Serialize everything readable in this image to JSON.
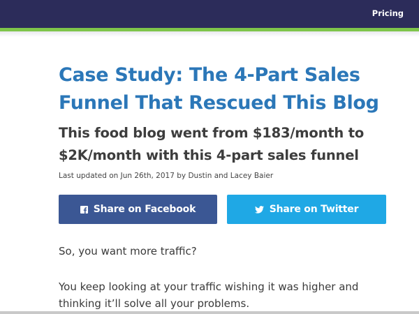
{
  "nav": {
    "pricing_label": "Pricing"
  },
  "article": {
    "title": "Case Study: The 4-Part Sales Funnel That Rescued This Blog",
    "subtitle": "This food blog went from $183/month to $2K/month with this 4-part sales funnel",
    "meta": "Last updated on Jun 26th, 2017 by Dustin and Lacey Baier",
    "paragraphs": [
      "So, you want more traffic?",
      "You keep looking at your traffic wishing it was higher and thinking it’ll solve all your problems."
    ]
  },
  "share": {
    "facebook_label": "Share on Facebook",
    "twitter_label": "Share on Twitter",
    "facebook_icon": "facebook-icon",
    "twitter_icon": "twitter-icon"
  },
  "colors": {
    "nav_bg": "#2c2c5a",
    "accent": "#7ec54a",
    "title": "#2b77b8",
    "facebook": "#3b5794",
    "twitter": "#1fa8e5"
  }
}
